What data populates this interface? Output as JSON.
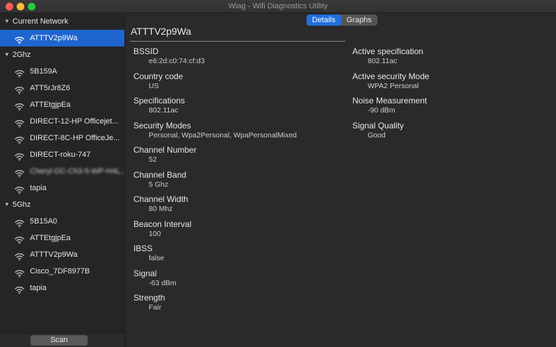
{
  "window": {
    "title": "Wiag - Wifi Diagnostics Utility"
  },
  "sidebar": {
    "groups": [
      {
        "label": "Current Network",
        "items": [
          {
            "label": "ATTTV2p9Wa",
            "selected": true
          }
        ]
      },
      {
        "label": "2Ghz",
        "items": [
          {
            "label": "5B159A"
          },
          {
            "label": "ATT5rJr8Z6"
          },
          {
            "label": "ATTEtgjpEa"
          },
          {
            "label": "DIRECT-12-HP Officejet..."
          },
          {
            "label": "DIRECT-8C-HP OfficeJe..."
          },
          {
            "label": "DIRECT-roku-747"
          },
          {
            "label": "Cheryl-DC-Ch3-5-WP-H4L...",
            "redacted": true
          },
          {
            "label": "tapia"
          }
        ]
      },
      {
        "label": "5Ghz",
        "items": [
          {
            "label": "5B15A0"
          },
          {
            "label": "ATTEtgjpEa"
          },
          {
            "label": "ATTTV2p9Wa"
          },
          {
            "label": "Cisco_7DF8977B"
          },
          {
            "label": "tapia"
          }
        ]
      }
    ],
    "scan_label": "Scan"
  },
  "tabs": [
    {
      "label": "Details",
      "active": true
    },
    {
      "label": "Graphs",
      "active": false
    }
  ],
  "details": {
    "network_name": "ATTTV2p9Wa",
    "left": [
      {
        "label": "BSSID",
        "value": "e6:2d:c0:74:cf:d3"
      },
      {
        "label": "Country code",
        "value": "US"
      },
      {
        "label": "Specifications",
        "value": "802.11ac"
      },
      {
        "label": "Security Modes",
        "value": "Personal, Wpa2Personal, WpaPersonalMixed"
      },
      {
        "label": "Channel Number",
        "value": "52"
      },
      {
        "label": "Channel Band",
        "value": "5 Ghz"
      },
      {
        "label": "Channel Width",
        "value": "80 Mhz"
      },
      {
        "label": "Beacon Interval",
        "value": "100"
      },
      {
        "label": "IBSS",
        "value": "false"
      },
      {
        "label": "Signal",
        "value": "-63 dBm"
      },
      {
        "label": "Strength",
        "value": "Fair"
      }
    ],
    "right": [
      {
        "label": "Active specification",
        "value": "802.11ac"
      },
      {
        "label": "Active security Mode",
        "value": "WPA2 Personal"
      },
      {
        "label": "Noise Measurement",
        "value": "-90 dBm"
      },
      {
        "label": "Signal Quality",
        "value": "Good"
      }
    ]
  },
  "colors": {
    "accent": "#1f65d0",
    "tab_active": "#1f6fe0",
    "background": "#2b2a2a"
  },
  "icons": {
    "network": "wifi-icon",
    "group_toggle": "disclosure-triangle-icon"
  }
}
